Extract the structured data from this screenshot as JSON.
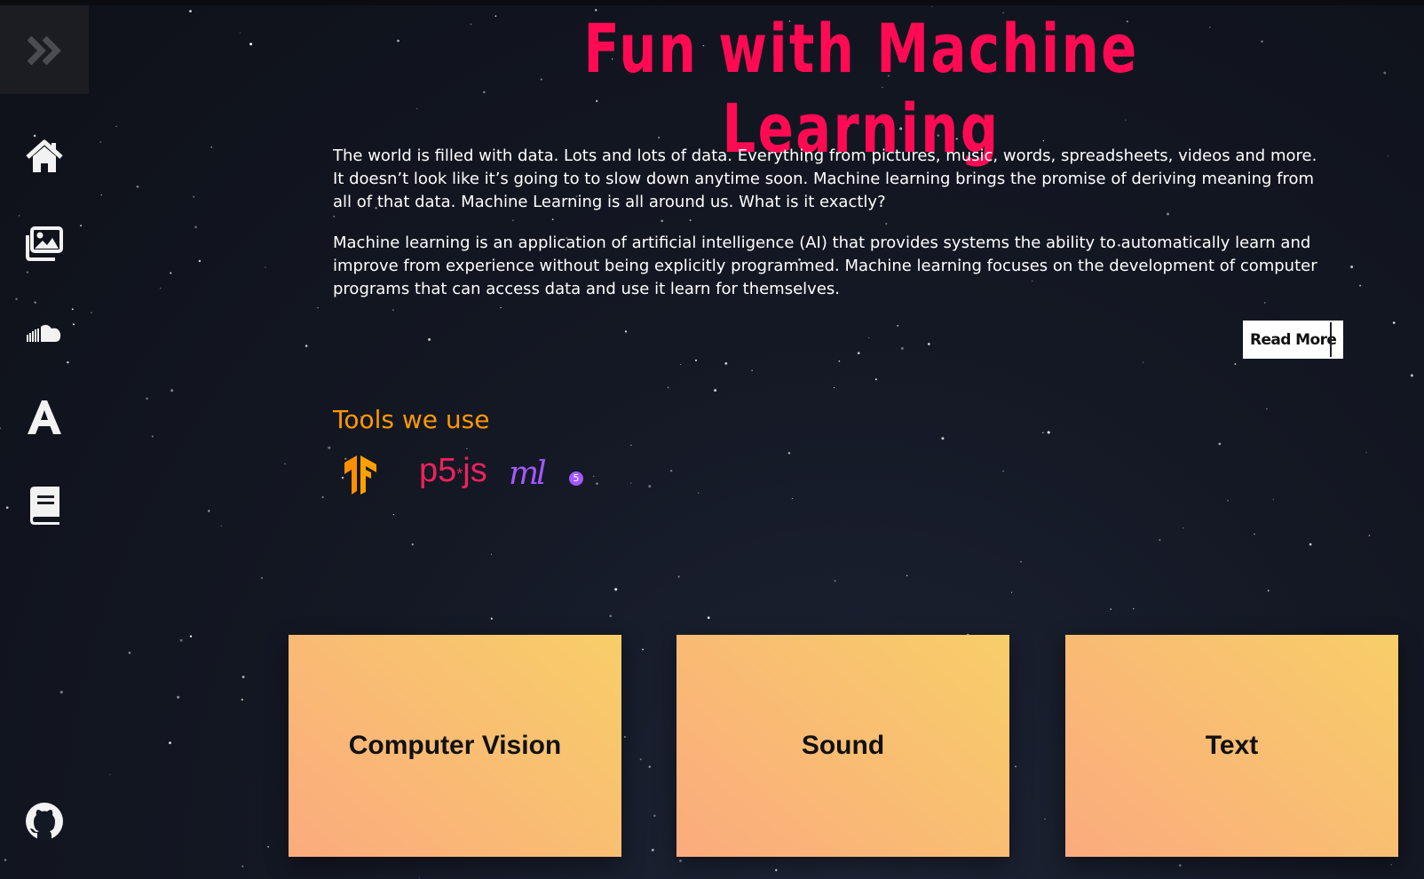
{
  "page": {
    "title": "Fun with Machine Learning",
    "paragraphs": [
      "The world is filled with data. Lots and lots of data. Everything from pictures, music, words, spreadsheets, videos and more. It doesn’t look like it’s going to to slow down anytime soon. Machine learning brings the promise of deriving meaning from all of that data. Machine Learning is all around us. What is it exactly?",
      "Machine learning is an application of artificial intelligence (AI) that provides systems the ability to automatically learn and improve from experience without being explicitly programmed. Machine learning focuses on the development of computer programs that can access data and use it learn for themselves."
    ],
    "read_more_label": "Read More"
  },
  "sidebar": {
    "expand_icon": "double-chevron-right-icon",
    "items": [
      {
        "icon": "home-icon"
      },
      {
        "icon": "images-icon"
      },
      {
        "icon": "soundcloud-icon"
      },
      {
        "icon": "font-icon"
      },
      {
        "icon": "book-icon"
      },
      {
        "icon": "github-icon"
      }
    ]
  },
  "tools": {
    "heading": "Tools we use",
    "logos": [
      {
        "name": "tensorflow-logo"
      },
      {
        "name": "p5js-logo",
        "text": "p5",
        "asterisk": "*",
        "suffix": "js"
      },
      {
        "name": "ml5-logo",
        "text": "ml",
        "badge": "5"
      }
    ]
  },
  "cards": [
    {
      "label": "Computer Vision"
    },
    {
      "label": "Sound"
    },
    {
      "label": "Text"
    }
  ],
  "colors": {
    "title": "#ff0a53",
    "tools_heading": "#ff9900",
    "card_gradient_start": "#fbab7e",
    "card_gradient_end": "#f7ce68",
    "background": "#141824"
  }
}
